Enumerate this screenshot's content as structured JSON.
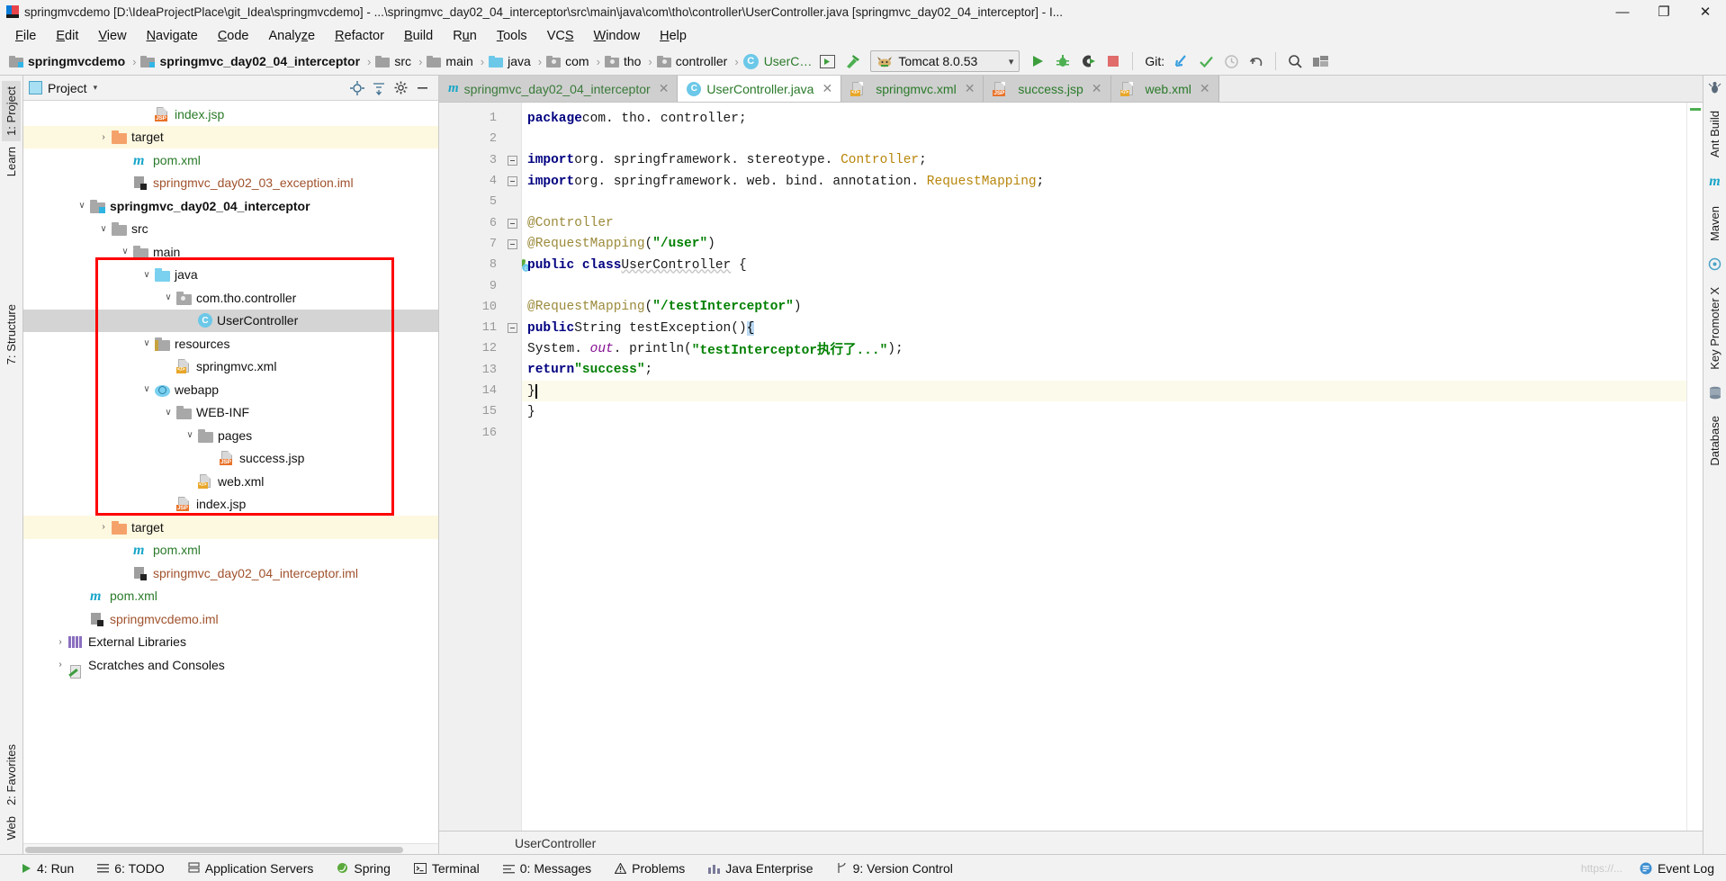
{
  "window": {
    "title": "springmvcdemo [D:\\IdeaProjectPlace\\git_Idea\\springmvcdemo] - ...\\springmvc_day02_04_interceptor\\src\\main\\java\\com\\tho\\controller\\UserController.java [springmvc_day02_04_interceptor] - I...",
    "minimize": "—",
    "maximize": "❐",
    "close": "✕",
    "app_icon": "intellij-idea-icon"
  },
  "menubar": {
    "items": [
      {
        "label": "File",
        "mnemonic": "F"
      },
      {
        "label": "Edit",
        "mnemonic": "E"
      },
      {
        "label": "View",
        "mnemonic": "V"
      },
      {
        "label": "Navigate",
        "mnemonic": "N"
      },
      {
        "label": "Code",
        "mnemonic": "C"
      },
      {
        "label": "Analyze",
        "mnemonic": "z"
      },
      {
        "label": "Refactor",
        "mnemonic": "R"
      },
      {
        "label": "Build",
        "mnemonic": "B"
      },
      {
        "label": "Run",
        "mnemonic": "u"
      },
      {
        "label": "Tools",
        "mnemonic": "T"
      },
      {
        "label": "VCS",
        "mnemonic": "S"
      },
      {
        "label": "Window",
        "mnemonic": "W"
      },
      {
        "label": "Help",
        "mnemonic": "H"
      }
    ]
  },
  "navbar": {
    "breadcrumbs": [
      {
        "label": "springmvcdemo",
        "icon": "module-icon",
        "bold": true
      },
      {
        "label": "springmvc_day02_04_interceptor",
        "icon": "module-icon",
        "bold": true
      },
      {
        "label": "src",
        "icon": "folder-gray-icon",
        "bold": false
      },
      {
        "label": "main",
        "icon": "folder-gray-icon",
        "bold": false
      },
      {
        "label": "java",
        "icon": "folder-source-icon",
        "bold": false
      },
      {
        "label": "com",
        "icon": "package-icon",
        "bold": false
      },
      {
        "label": "tho",
        "icon": "package-icon",
        "bold": false
      },
      {
        "label": "controller",
        "icon": "package-icon",
        "bold": false
      },
      {
        "label": "UserC…",
        "icon": "class-icon",
        "bold": false
      }
    ],
    "separator": "›",
    "run_config": {
      "label": "Tomcat 8.0.53",
      "icon": "tomcat-icon",
      "dropdown": "⌵"
    },
    "buttons": [
      {
        "name": "run-config-selector-icon",
        "glyph": "▶"
      },
      {
        "name": "build-hammer-icon",
        "glyph": "⚒"
      },
      {
        "name": "run-button",
        "glyph": "▶"
      },
      {
        "name": "debug-button",
        "glyph": "bug"
      },
      {
        "name": "run-coverage-button",
        "glyph": "coverage"
      },
      {
        "name": "stop-button",
        "glyph": "■"
      }
    ],
    "git_label": "Git:",
    "git_buttons": [
      {
        "name": "update-project-icon",
        "glyph": "↙"
      },
      {
        "name": "commit-icon",
        "glyph": "✓"
      },
      {
        "name": "history-icon",
        "glyph": "◷"
      },
      {
        "name": "rollback-icon",
        "glyph": "↶"
      }
    ],
    "right_buttons": [
      {
        "name": "search-everywhere-icon",
        "glyph": "⚲"
      },
      {
        "name": "project-structure-icon",
        "glyph": "⌸"
      }
    ]
  },
  "left_strip": {
    "tabs": [
      {
        "label": "1: Project",
        "selected": true
      },
      {
        "label": "Learn",
        "selected": false
      },
      {
        "label": "7: Structure",
        "selected": false
      },
      {
        "label": "2: Favorites",
        "selected": false
      },
      {
        "label": "Web",
        "selected": false
      }
    ]
  },
  "right_strip": {
    "tabs": [
      {
        "label": "Ant Build"
      },
      {
        "label": "Maven"
      },
      {
        "label": "Key Promoter X"
      },
      {
        "label": "Database"
      }
    ]
  },
  "project_panel": {
    "title": "Project",
    "dropdown": "▾",
    "header_buttons": [
      {
        "name": "select-opened-file-icon",
        "glyph": "⊕"
      },
      {
        "name": "collapse-all-icon",
        "glyph": "⤓"
      },
      {
        "name": "settings-gear-icon",
        "glyph": "⚙"
      },
      {
        "name": "hide-panel-icon",
        "glyph": "—"
      }
    ],
    "tree": [
      {
        "label": "index.jsp",
        "indent": 5,
        "arrow": "none",
        "icon": "jsp-file-icon",
        "color": "green",
        "bold": false,
        "state": "normal"
      },
      {
        "label": "target",
        "indent": 3,
        "arrow": "right",
        "icon": "folder-orange-icon",
        "color": "black",
        "bold": false,
        "state": "yellow"
      },
      {
        "label": "pom.xml",
        "indent": 4,
        "arrow": "none",
        "icon": "maven-m-icon",
        "color": "green",
        "bold": false,
        "state": "normal"
      },
      {
        "label": "springmvc_day02_03_exception.iml",
        "indent": 4,
        "arrow": "none",
        "icon": "iml-file-icon",
        "color": "brown",
        "bold": false,
        "state": "normal"
      },
      {
        "label": "springmvc_day02_04_interceptor",
        "indent": 2,
        "arrow": "down",
        "icon": "module-icon",
        "color": "black",
        "bold": true,
        "state": "normal"
      },
      {
        "label": "src",
        "indent": 3,
        "arrow": "down",
        "icon": "folder-gray-icon",
        "color": "black",
        "bold": false,
        "state": "normal"
      },
      {
        "label": "main",
        "indent": 4,
        "arrow": "down",
        "icon": "folder-gray-icon",
        "color": "black",
        "bold": false,
        "state": "normal"
      },
      {
        "label": "java",
        "indent": 5,
        "arrow": "down",
        "icon": "folder-source-icon",
        "color": "black",
        "bold": false,
        "state": "normal"
      },
      {
        "label": "com.tho.controller",
        "indent": 6,
        "arrow": "down",
        "icon": "package-icon",
        "color": "black",
        "bold": false,
        "state": "normal"
      },
      {
        "label": "UserController",
        "indent": 7,
        "arrow": "none",
        "icon": "class-icon",
        "color": "black",
        "bold": false,
        "state": "selected"
      },
      {
        "label": "resources",
        "indent": 5,
        "arrow": "down",
        "icon": "resources-icon",
        "color": "black",
        "bold": false,
        "state": "normal"
      },
      {
        "label": "springmvc.xml",
        "indent": 6,
        "arrow": "none",
        "icon": "xml-file-icon",
        "color": "black",
        "bold": false,
        "state": "normal"
      },
      {
        "label": "webapp",
        "indent": 5,
        "arrow": "down",
        "icon": "webapp-icon",
        "color": "black",
        "bold": false,
        "state": "normal"
      },
      {
        "label": "WEB-INF",
        "indent": 6,
        "arrow": "down",
        "icon": "folder-gray-icon",
        "color": "black",
        "bold": false,
        "state": "normal"
      },
      {
        "label": "pages",
        "indent": 7,
        "arrow": "down",
        "icon": "folder-gray-icon",
        "color": "black",
        "bold": false,
        "state": "normal"
      },
      {
        "label": "success.jsp",
        "indent": 8,
        "arrow": "none",
        "icon": "jsp-file-icon",
        "color": "black",
        "bold": false,
        "state": "normal"
      },
      {
        "label": "web.xml",
        "indent": 7,
        "arrow": "none",
        "icon": "xml-file-icon",
        "color": "black",
        "bold": false,
        "state": "normal"
      },
      {
        "label": "index.jsp",
        "indent": 6,
        "arrow": "none",
        "icon": "jsp-file-icon",
        "color": "black",
        "bold": false,
        "state": "normal"
      },
      {
        "label": "target",
        "indent": 3,
        "arrow": "right",
        "icon": "folder-orange-icon",
        "color": "black",
        "bold": false,
        "state": "yellow"
      },
      {
        "label": "pom.xml",
        "indent": 4,
        "arrow": "none",
        "icon": "maven-m-icon",
        "color": "green",
        "bold": false,
        "state": "normal"
      },
      {
        "label": "springmvc_day02_04_interceptor.iml",
        "indent": 4,
        "arrow": "none",
        "icon": "iml-file-icon",
        "color": "brown",
        "bold": false,
        "state": "normal"
      },
      {
        "label": "pom.xml",
        "indent": 2,
        "arrow": "none",
        "icon": "maven-m-icon",
        "color": "green",
        "bold": false,
        "state": "normal"
      },
      {
        "label": "springmvcdemo.iml",
        "indent": 2,
        "arrow": "none",
        "icon": "iml-file-icon",
        "color": "brown",
        "bold": false,
        "state": "normal"
      },
      {
        "label": "External Libraries",
        "indent": 1,
        "arrow": "right",
        "icon": "libraries-icon",
        "color": "black",
        "bold": false,
        "state": "normal"
      },
      {
        "label": "Scratches and Consoles",
        "indent": 1,
        "arrow": "right",
        "icon": "scratches-icon",
        "color": "black",
        "bold": false,
        "state": "normal"
      }
    ]
  },
  "editor": {
    "tabs": [
      {
        "label": "springmvc_day02_04_interceptor",
        "icon": "maven-m-icon",
        "color": "#3a7a3a",
        "active": false,
        "close": "✕"
      },
      {
        "label": "UserController.java",
        "icon": "class-icon",
        "color": "#2a7a2a",
        "active": true,
        "close": "✕"
      },
      {
        "label": "springmvc.xml",
        "icon": "xml-file-icon",
        "color": "#2a7a2a",
        "active": false,
        "close": "✕"
      },
      {
        "label": "success.jsp",
        "icon": "jsp-file-icon",
        "color": "#2a7a2a",
        "active": false,
        "close": "✕"
      },
      {
        "label": "web.xml",
        "icon": "xml-file-icon",
        "color": "#2a7a2a",
        "active": false,
        "close": "✕"
      }
    ],
    "line_numbers": [
      "1",
      "2",
      "3",
      "4",
      "5",
      "6",
      "7",
      "8",
      "9",
      "10",
      "11",
      "12",
      "13",
      "14",
      "15",
      "16"
    ],
    "code_lines": [
      {
        "n": 1,
        "html": "<span class='kw'>package</span> <span class='plain'>com. tho. controller;</span>"
      },
      {
        "n": 2,
        "html": ""
      },
      {
        "n": 3,
        "html": "<span class='kw'>import</span> <span class='plain'>org. springframework. stereotype.</span><span class='cls-ref'> Controller</span><span class='plain'>;</span>"
      },
      {
        "n": 4,
        "html": "<span class='kw'>import</span> <span class='plain'>org. springframework. web. bind. annotation.</span><span class='cls-ref'> RequestMapping</span><span class='plain'>;</span>"
      },
      {
        "n": 5,
        "html": ""
      },
      {
        "n": 6,
        "html": "<span class='ann'>@Controller</span>"
      },
      {
        "n": 7,
        "html": "<span class='ann'>@RequestMapping</span><span class='plain'>(</span><span class='str'>\"/user\"</span><span class='plain'>)</span>"
      },
      {
        "n": 8,
        "html": "<span class='kw'>public class</span> <span class='plain squiggle'>UserController</span><span class='plain'> {</span>"
      },
      {
        "n": 9,
        "html": ""
      },
      {
        "n": 10,
        "html": "    <span class='ann'>@RequestMapping</span><span class='plain'>(</span><span class='str'>\"/testInterceptor\"</span><span class='plain'>)</span>"
      },
      {
        "n": 11,
        "html": "    <span class='kw'>public</span> <span class='plain'>String testException()</span><span class='hl-brace'>{</span>"
      },
      {
        "n": 12,
        "html": "        <span class='plain'>System. </span><span class='field-it'>out</span><span class='plain'>. println(</span><span class='str'>\"testInterceptor执行了...\"</span><span class='plain'>);</span>"
      },
      {
        "n": 13,
        "html": "        <span class='kw'>return</span> <span class='str'>\"success\"</span><span class='plain'>;</span>"
      },
      {
        "n": 14,
        "html": "    <span class='plain'>}</span><span class='caret-blk'></span>"
      },
      {
        "n": 15,
        "html": "<span class='plain'>}</span>"
      },
      {
        "n": 16,
        "html": ""
      }
    ],
    "code_text": [
      "package com. tho. controller;",
      "",
      "import org. springframework. stereotype. Controller;",
      "import org. springframework. web. bind. annotation. RequestMapping;",
      "",
      "@Controller",
      "@RequestMapping(\"/user\")",
      "public class UserController {",
      "",
      "    @RequestMapping(\"/testInterceptor\")",
      "    public String testException(){",
      "        System. out. println(\"testInterceptor执行了...\");",
      "        return \"success\";",
      "    }",
      "}",
      ""
    ],
    "breadcrumb": "UserController",
    "current_line": 14
  },
  "statusbar": {
    "items": [
      {
        "label": "4: Run",
        "icon": "run-icon"
      },
      {
        "label": "6: TODO",
        "icon": "todo-icon"
      },
      {
        "label": "Application Servers",
        "icon": "server-icon"
      },
      {
        "label": "Spring",
        "icon": "spring-icon"
      },
      {
        "label": "Terminal",
        "icon": "terminal-icon"
      },
      {
        "label": "0: Messages",
        "icon": "messages-icon"
      },
      {
        "label": "Problems",
        "icon": "warning-icon"
      },
      {
        "label": "Java Enterprise",
        "icon": "java-ee-icon"
      },
      {
        "label": "9: Version Control",
        "icon": "vcs-icon"
      }
    ],
    "event_log": {
      "label": "Event Log",
      "icon": "event-log-icon"
    },
    "watermark": "https://..."
  },
  "annotation": {
    "redbox_color": "#ff0000",
    "redbox_label": "highlighted-project-subtree"
  },
  "colors": {
    "accent_blue": "#6cc8e8",
    "folder_orange": "#f5a26a",
    "folder_gray": "#a8a8a8",
    "string_green": "#008000",
    "keyword_navy": "#000080",
    "annotation_olive": "#9b8a3a",
    "selection_gray": "#d4dctd4",
    "current_line_yellow": "#fcfaea"
  }
}
